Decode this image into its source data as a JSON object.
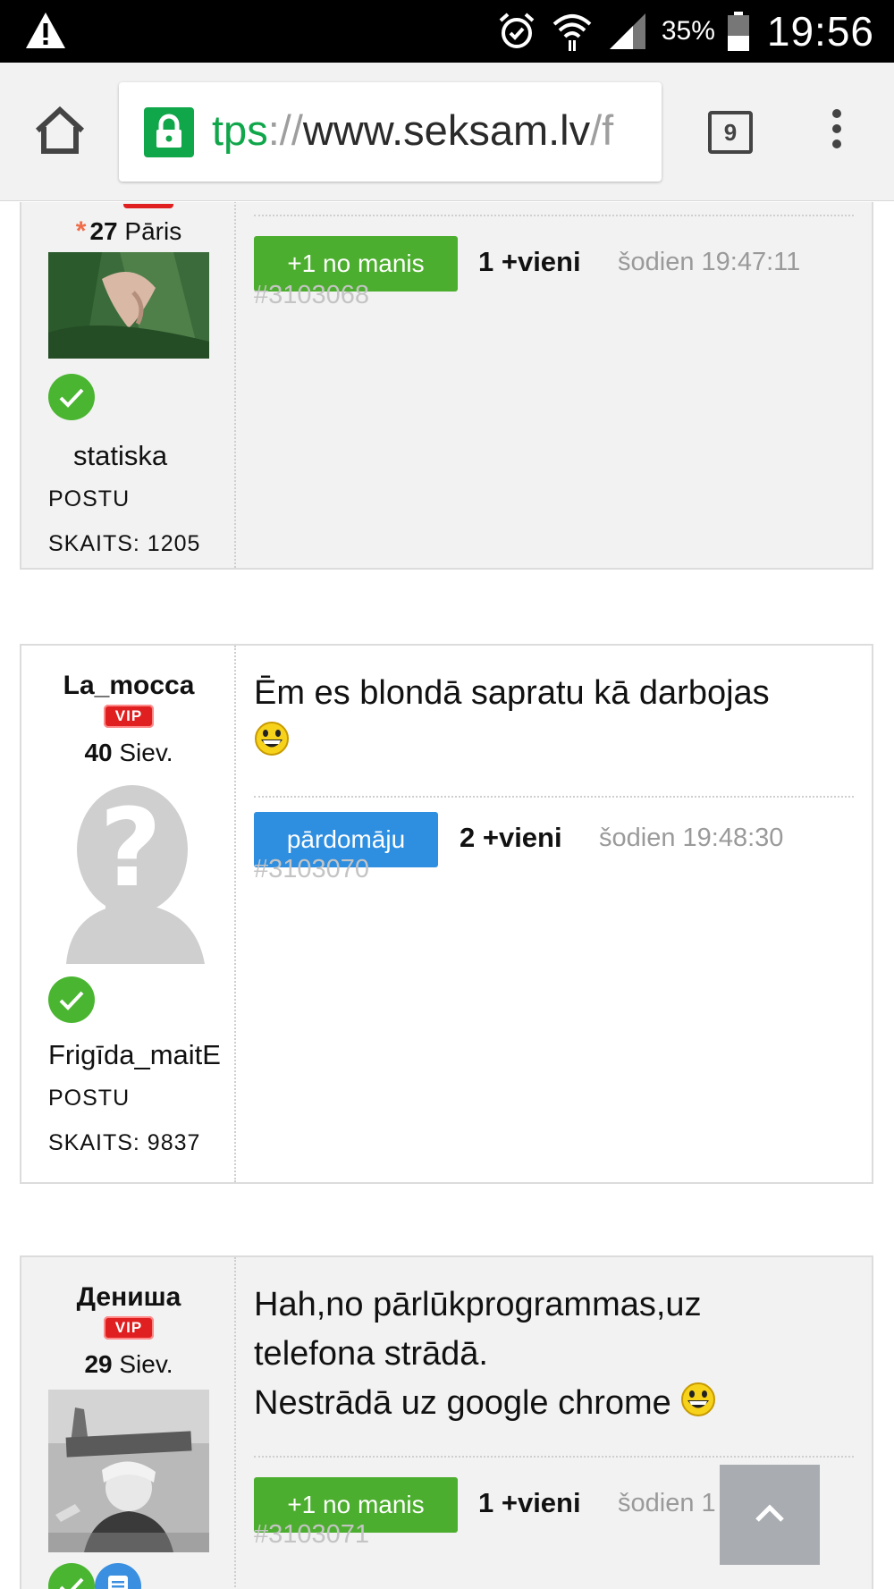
{
  "status_bar": {
    "battery_percent": "35%",
    "time": "19:56",
    "icons": [
      "warning-icon",
      "alarm-icon",
      "wifi-icon",
      "signal-icon",
      "battery-icon"
    ]
  },
  "browser": {
    "url_scheme": "tps",
    "url_sep": "://",
    "url_host": "www.seksam.lv",
    "url_path": "/f",
    "tab_count": "9",
    "secure_color": "#10a64a"
  },
  "posts": [
    {
      "age": "27",
      "sex": "Pāris",
      "status": "statiska",
      "meta_label": "POSTU",
      "meta_count": "SKAITS: 1205",
      "button_label": "+1 no manis",
      "votes": "1 +vieni",
      "time": "šodien 19:47:11",
      "post_id": "#3103068"
    },
    {
      "username": "La_mocca",
      "vip": "VIP",
      "age": "40",
      "sex": "Siev.",
      "status": "Frigīda_maitE",
      "meta_label": "POSTU",
      "meta_count": "SKAITS: 9837",
      "message": "Ēm es blondā sapratu kā darbojas",
      "button_label": "pārdomāju",
      "votes": "2 +vieni",
      "time": "šodien 19:48:30",
      "post_id": "#3103070"
    },
    {
      "username": "Дениша",
      "vip": "VIP",
      "age": "29",
      "sex": "Siev.",
      "message_line1": "Hah,no pārlūkprogrammas,uz",
      "message_line2": "telefona strādā.",
      "message_line3": "Nestrādā uz google chrome",
      "button_label": "+1 no manis",
      "votes": "1 +vieni",
      "time": "šodien 1",
      "post_id": "#3103071"
    }
  ],
  "colors": {
    "vip_red": "#e02020",
    "button_green": "#4cae2e",
    "button_blue": "#2e8ee0",
    "verified_green": "#4ab531"
  }
}
